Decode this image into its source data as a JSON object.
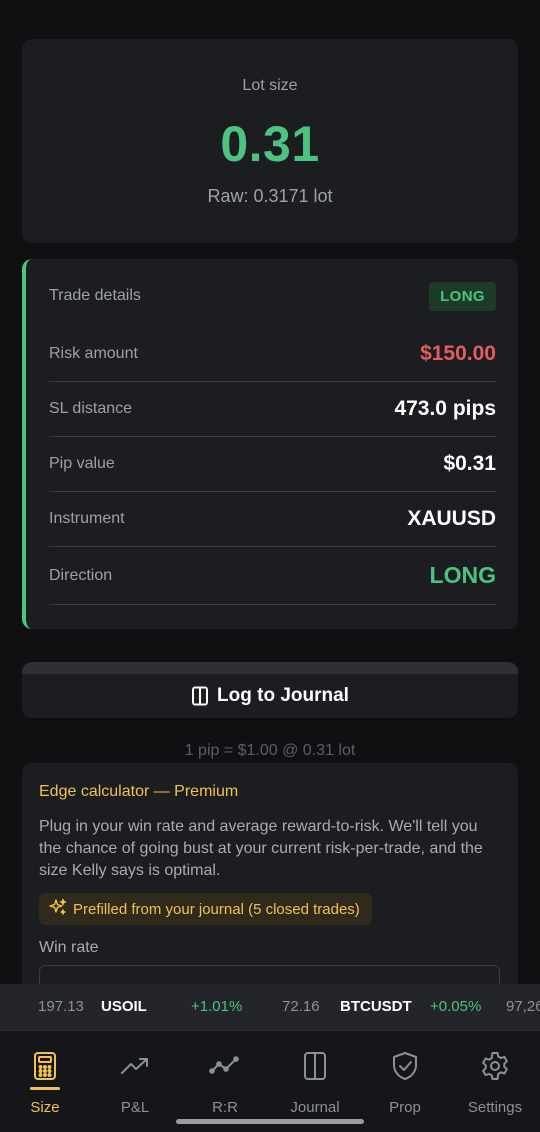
{
  "lot": {
    "label": "Lot size",
    "value": "0.31",
    "raw": "Raw: 0.3171 lot"
  },
  "details": {
    "title": "Trade details",
    "badge": "LONG",
    "rows": [
      {
        "label": "Risk amount",
        "value": "$150.00"
      },
      {
        "label": "SL distance",
        "value": "473.0 pips"
      },
      {
        "label": "Pip value",
        "value": "$0.31"
      },
      {
        "label": "Instrument",
        "value": "XAUUSD"
      },
      {
        "label": "Direction",
        "value": "LONG"
      }
    ]
  },
  "journal_button": {
    "label": "Log to Journal",
    "icon": "book-icon"
  },
  "pip_note": "1 pip = $1.00 @ 0.31 lot",
  "edge": {
    "title": "Edge calculator — Premium",
    "description": "Plug in your win rate and average reward-to-risk. We'll tell you the chance of going bust at your current risk-per-trade, and the size Kelly says is optimal.",
    "prefill": "Prefilled from your journal (5 closed trades)",
    "win_rate_label": "Win rate"
  },
  "ticker": [
    {
      "text": "197.13",
      "kind": "num"
    },
    {
      "text": "USOIL",
      "kind": "sym"
    },
    {
      "text": "+1.01%",
      "kind": "pct"
    },
    {
      "text": "72.16",
      "kind": "num"
    },
    {
      "text": "BTCUSDT",
      "kind": "sym"
    },
    {
      "text": "+0.05%",
      "kind": "pct"
    },
    {
      "text": "97,26",
      "kind": "num"
    }
  ],
  "nav": [
    {
      "label": "Size",
      "icon": "calculator-icon",
      "active": true
    },
    {
      "label": "P&L",
      "icon": "trend-up-icon",
      "active": false
    },
    {
      "label": "R:R",
      "icon": "chart-line-icon",
      "active": false
    },
    {
      "label": "Journal",
      "icon": "book-icon",
      "active": false
    },
    {
      "label": "Prop",
      "icon": "shield-check-icon",
      "active": false
    },
    {
      "label": "Settings",
      "icon": "gear-icon",
      "active": false
    }
  ],
  "colors": {
    "accent": "#f1c24f",
    "positive": "#4cc37e",
    "negative": "#e35d5d"
  }
}
